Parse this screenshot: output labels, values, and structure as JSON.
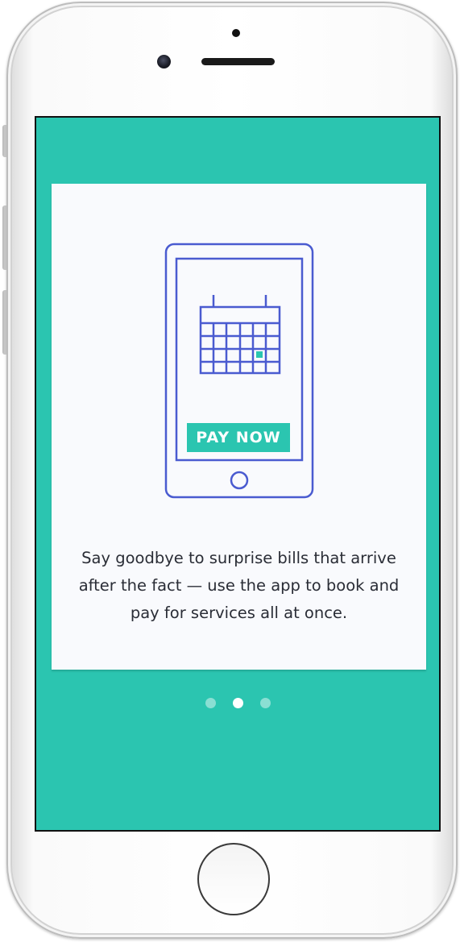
{
  "onboarding": {
    "button_label": "PAY NOW",
    "message": "Say goodbye to surprise bills that arrive after the fact — use the app to book and pay for services all at once.",
    "pagination": {
      "total": 3,
      "active_index": 1
    }
  },
  "colors": {
    "teal": "#2bc5b0",
    "illustration_blue": "#4a5bd0",
    "card": "#f9fafd",
    "text": "#2a2d36"
  },
  "icons": {
    "illustration": "phone-with-calendar-icon",
    "device_camera": "camera-icon",
    "device_home": "home-button-icon"
  }
}
